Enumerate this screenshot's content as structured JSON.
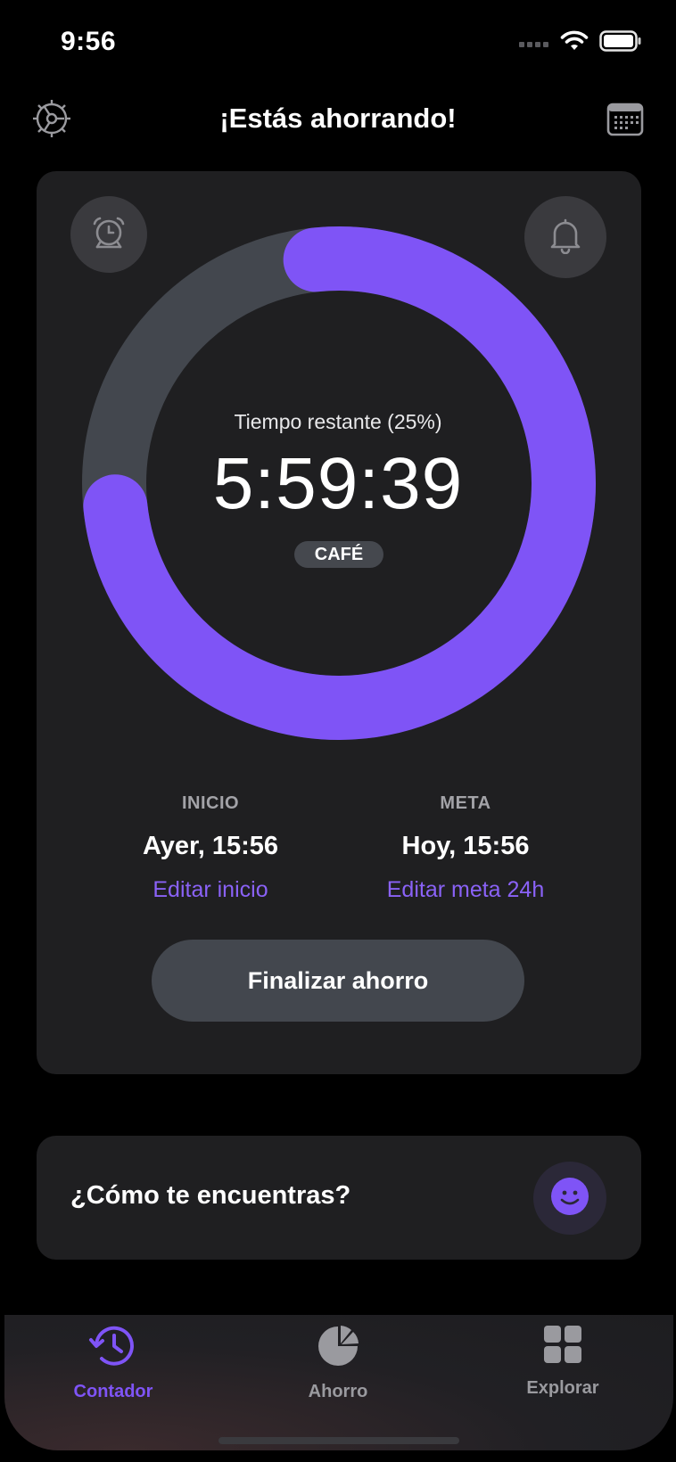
{
  "status_bar": {
    "time": "9:56"
  },
  "header": {
    "title": "¡Estás ahorrando!",
    "left_icon": "gear-icon",
    "right_icon": "calendar-icon"
  },
  "timer": {
    "remaining_label": "Tiempo restante (25%)",
    "value": "5:59:39",
    "badge": "CAFÉ",
    "progress_fraction": 0.75,
    "accent_color": "#7f54f6",
    "track_color": "#43474e",
    "left_button_icon": "alarm-clock-icon",
    "right_button_icon": "bell-icon"
  },
  "start": {
    "heading": "INICIO",
    "value": "Ayer, 15:56",
    "link": "Editar inicio"
  },
  "goal": {
    "heading": "META",
    "value": "Hoy, 15:56",
    "link": "Editar meta 24h"
  },
  "finish_button": "Finalizar ahorro",
  "mood": {
    "question": "¿Cómo te encuentras?",
    "icon": "smiley-icon"
  },
  "tabs": [
    {
      "label": "Contador",
      "icon": "history-clock-icon",
      "active": true
    },
    {
      "label": "Ahorro",
      "icon": "pie-chart-icon",
      "active": false
    },
    {
      "label": "Explorar",
      "icon": "grid-icon",
      "active": false
    }
  ],
  "colors": {
    "accent": "#7f54f6",
    "link": "#8a62f7",
    "inactive_tab": "#9a9a9f"
  }
}
